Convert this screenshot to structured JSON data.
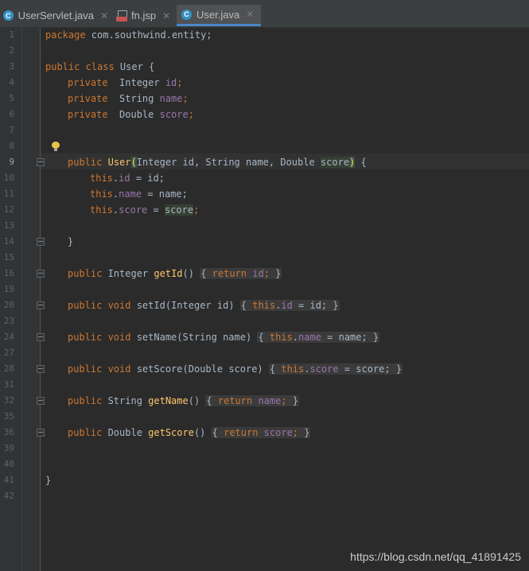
{
  "tabs": [
    {
      "label": "UserServlet.java",
      "icon": "java-class-icon",
      "active": false
    },
    {
      "label": "fn.jsp",
      "icon": "jsp-file-icon",
      "active": false
    },
    {
      "label": "User.java",
      "icon": "java-class-icon",
      "active": true
    }
  ],
  "line_numbers": [
    "1",
    "2",
    "3",
    "4",
    "5",
    "6",
    "7",
    "8",
    "9",
    "10",
    "11",
    "12",
    "13",
    "14",
    "15",
    "16",
    "19",
    "20",
    "23",
    "24",
    "27",
    "28",
    "31",
    "32",
    "35",
    "36",
    "39",
    "40",
    "41",
    "42"
  ],
  "code": {
    "l1": [
      "package",
      " com.southwind.entity;"
    ],
    "l3": [
      "public class",
      " User {"
    ],
    "l4": [
      "private",
      "  Integer ",
      "id",
      ";"
    ],
    "l5": [
      "private",
      "  String ",
      "name",
      ";"
    ],
    "l6": [
      "private",
      "  Double ",
      "score",
      ";"
    ],
    "l9": [
      "public",
      " ",
      "User",
      "(",
      "Integer id, String name, Double ",
      "score",
      ")",
      " {"
    ],
    "l10": [
      "this",
      ".",
      "id",
      " = id;"
    ],
    "l11": [
      "this",
      ".",
      "name",
      " = name;"
    ],
    "l12": [
      "this",
      ".",
      "score",
      " = ",
      "score",
      ";"
    ],
    "l14": [
      "}"
    ],
    "l16": [
      "public",
      " Integer ",
      "getId",
      "() ",
      "{",
      " return ",
      "id",
      ";",
      " }"
    ],
    "l20": [
      "public void",
      " setId",
      "(Integer id) ",
      "{",
      " this",
      ".",
      "id",
      " = id;",
      " }"
    ],
    "l24": [
      "public void",
      " setName",
      "(String name) ",
      "{",
      " this",
      ".",
      "name",
      " = name;",
      " }"
    ],
    "l28": [
      "public void",
      " setScore",
      "(Double score) ",
      "{",
      " this",
      ".",
      "score",
      " = score;",
      " }"
    ],
    "l32": [
      "public",
      " String ",
      "getName",
      "() ",
      "{",
      " return ",
      "name",
      ";",
      " }"
    ],
    "l36": [
      "public",
      " Double ",
      "getScore",
      "() ",
      "{",
      " return ",
      "score",
      ";",
      " }"
    ],
    "l41": [
      "}"
    ]
  },
  "watermark": "https://blog.csdn.net/qq_41891425",
  "colors": {
    "keyword": "#cc7832",
    "field": "#9876aa",
    "method": "#ffc66d",
    "text": "#a9b7c6",
    "background": "#2b2b2b"
  }
}
